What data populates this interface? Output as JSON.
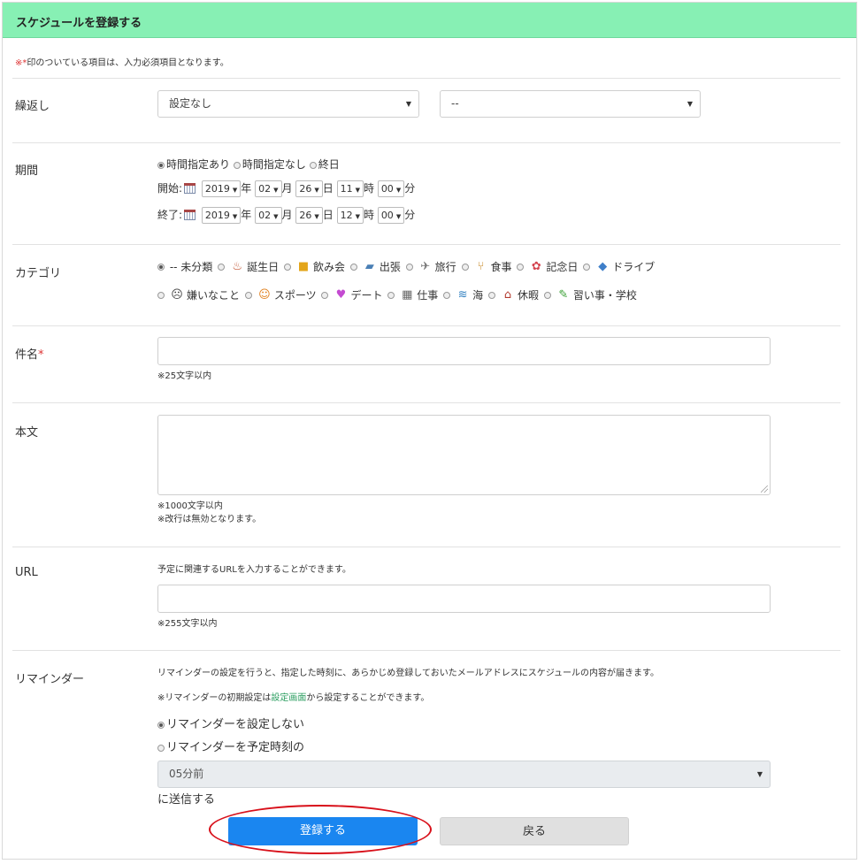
{
  "header": {
    "title": "スケジュールを登録する"
  },
  "note": {
    "mark": "※*",
    "text": "印のついている項目は、入力必須項目となります。"
  },
  "repeat": {
    "label": "繰返し",
    "select1": "設定なし",
    "select2": "--"
  },
  "period": {
    "label": "期間",
    "options": [
      "時間指定あり",
      "時間指定なし",
      "終日"
    ],
    "start_label": "開始:",
    "end_label": "終了:",
    "start": {
      "year": "2019",
      "month": "02",
      "day": "26",
      "hour": "11",
      "minute": "00"
    },
    "end": {
      "year": "2019",
      "month": "02",
      "day": "26",
      "hour": "12",
      "minute": "00"
    },
    "units": {
      "year": "年",
      "month": "月",
      "day": "日",
      "hour": "時",
      "minute": "分"
    }
  },
  "category": {
    "label": "カテゴリ",
    "row1": [
      "-- 未分類",
      "誕生日",
      "飲み会",
      "出張",
      "旅行",
      "食事",
      "記念日",
      "ドライブ"
    ],
    "row2": [
      "嫌いなこと",
      "スポーツ",
      "デート",
      "仕事",
      "海",
      "休暇",
      "習い事・学校"
    ],
    "icons_row2": [
      "skull-icon",
      "runner-icon",
      "heart-icon",
      "building-icon",
      "wave-icon",
      "house-icon",
      "pencil-icon"
    ]
  },
  "subject": {
    "label": "件名",
    "required": "*",
    "hint": "※25文字以内"
  },
  "body": {
    "label": "本文",
    "hint1": "※1000文字以内",
    "hint2": "※改行は無効となります。"
  },
  "url": {
    "label": "URL",
    "desc": "予定に関連するURLを入力することができます。",
    "hint": "※255文字以内"
  },
  "reminder": {
    "label": "リマインダー",
    "desc": "リマインダーの設定を行うと、指定した時刻に、あらかじめ登録しておいたメールアドレスにスケジュールの内容が届きます。",
    "note_before": "※リマインダーの初期設定は",
    "note_link": "設定画面",
    "note_after": "から設定することができます。",
    "opt_off": "リマインダーを設定しない",
    "opt_on": "リマインダーを予定時刻の",
    "select": "05分前",
    "suffix": "に送信する"
  },
  "buttons": {
    "submit": "登録する",
    "back": "戻る"
  },
  "colors": {
    "header_bg": "#87f0b4",
    "primary": "#1a86f0",
    "highlight_oval": "#d8101a"
  }
}
